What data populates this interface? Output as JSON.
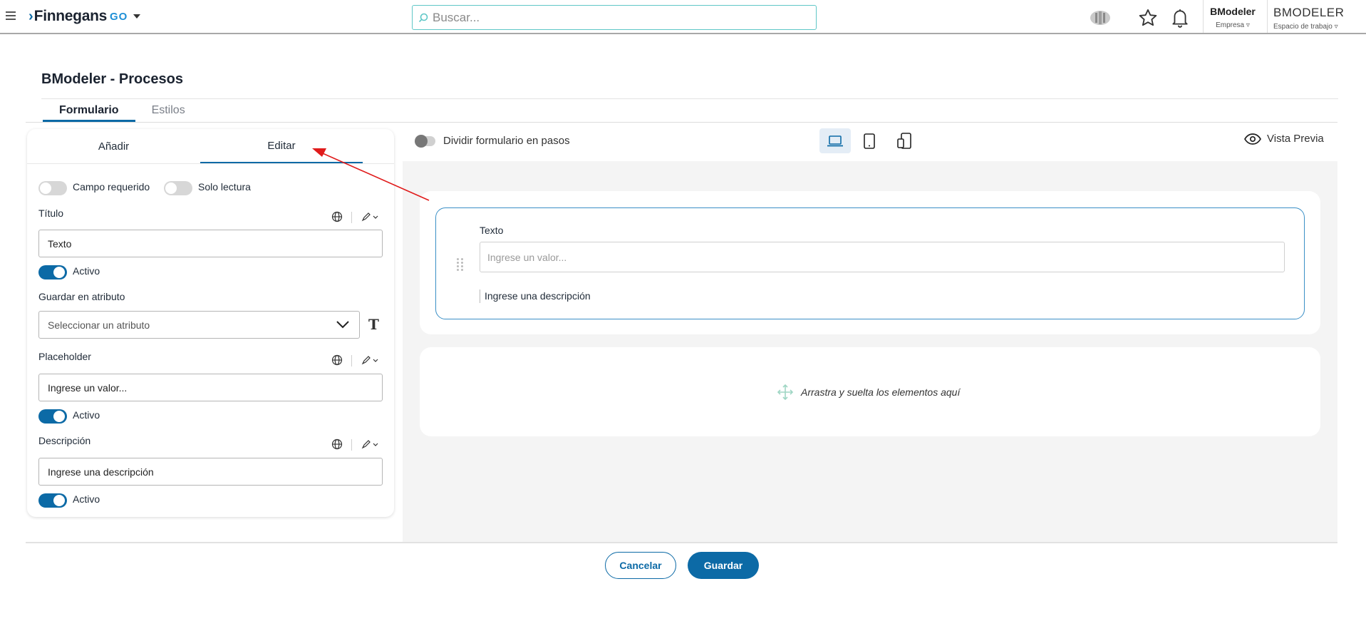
{
  "topbar": {
    "brand_name": "Finnegans",
    "brand_suffix": "GO",
    "search_placeholder": "Buscar...",
    "company_name": "BModeler",
    "company_label": "Empresa ▿",
    "workspace_name": "BMODELER",
    "workspace_label": "Espacio de trabajo ▿"
  },
  "page": {
    "title": "BModeler - Procesos",
    "tabs": [
      {
        "label": "Formulario",
        "active": true
      },
      {
        "label": "Estilos",
        "active": false
      }
    ]
  },
  "left_panel": {
    "tabs": [
      {
        "label": "Añadir",
        "active": false
      },
      {
        "label": "Editar",
        "active": true
      }
    ],
    "toggles": {
      "required_label": "Campo requerido",
      "readonly_label": "Solo lectura"
    },
    "title_field": {
      "label": "Título",
      "value": "Texto",
      "active_label": "Activo"
    },
    "attribute_field": {
      "label": "Guardar en atributo",
      "placeholder": "Seleccionar un atributo"
    },
    "placeholder_field": {
      "label": "Placeholder",
      "value": "Ingrese un valor...",
      "active_label": "Activo"
    },
    "description_field": {
      "label": "Descripción",
      "value": "Ingrese una descripción",
      "active_label": "Activo"
    }
  },
  "editor": {
    "split_steps_label": "Dividir formulario en pasos",
    "preview_label": "Vista Previa",
    "devices": [
      "laptop-icon",
      "tablet-icon",
      "mobile-icon"
    ],
    "selected_device": "laptop",
    "form_field": {
      "label": "Texto",
      "placeholder": "Ingrese un valor...",
      "description": "Ingrese una descripción"
    },
    "drop_zone_text": "Arrastra y suelta los elementos aquí"
  },
  "footer": {
    "cancel_label": "Cancelar",
    "save_label": "Guardar"
  },
  "colors": {
    "primary": "#0c6aa6",
    "annotation_arrow": "#e01b1b",
    "canvas_bg": "#f4f4f4"
  }
}
